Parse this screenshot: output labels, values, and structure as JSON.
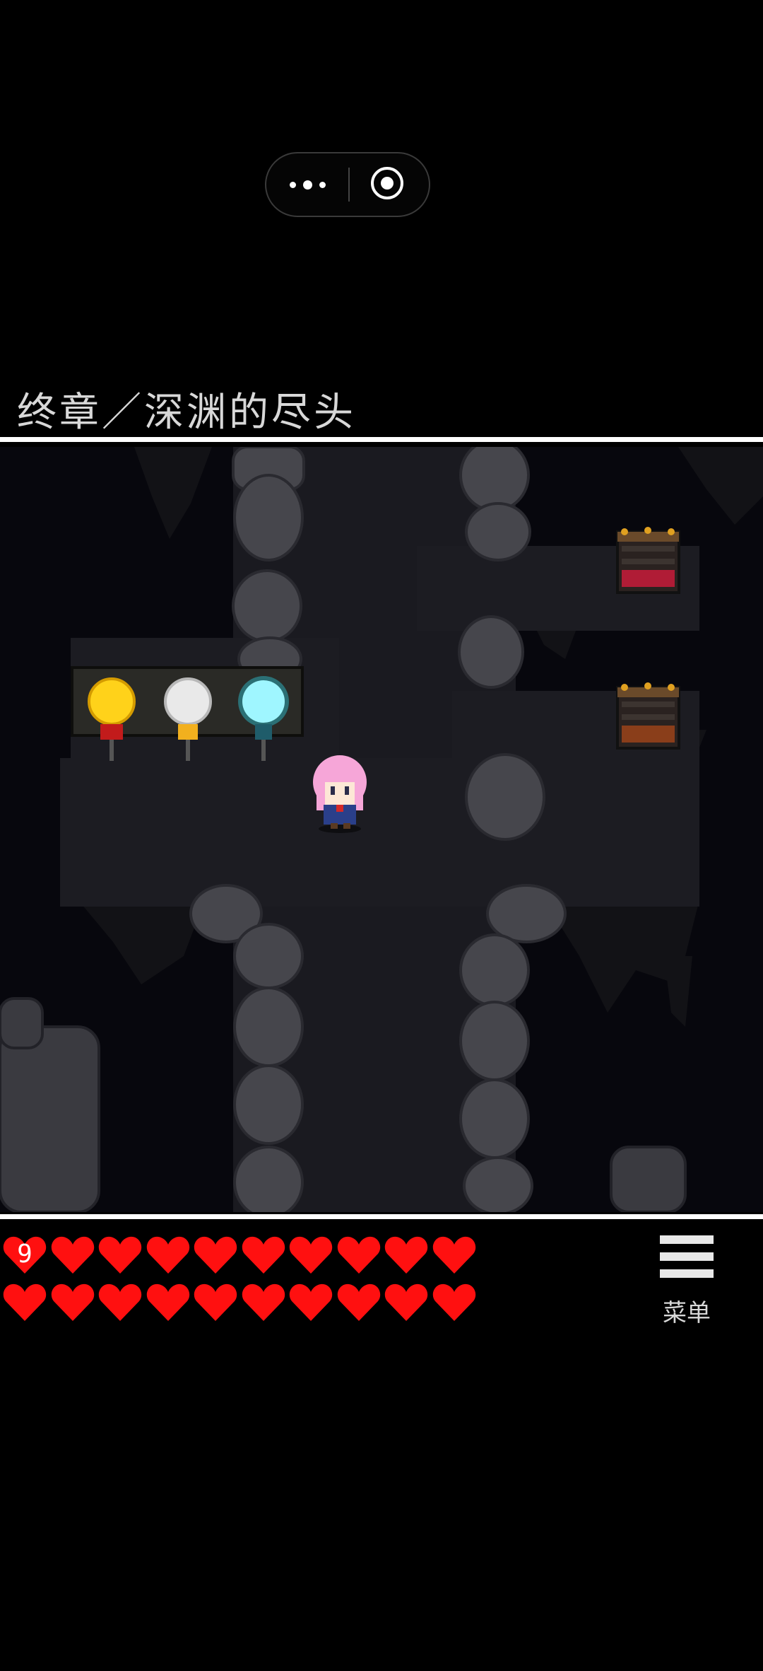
{
  "chapter": {
    "title": "终章／深渊的尽头"
  },
  "hud": {
    "hearts_total": 20,
    "hearts_first_badge": "9",
    "heart_color": "#ff1010"
  },
  "menu": {
    "label": "菜单",
    "icon": "hamburger-menu-icon"
  },
  "scene": {
    "lamps": [
      {
        "name": "yellow-lamp",
        "color": "#ffd21a"
      },
      {
        "name": "white-lamp",
        "color": "#e9e9e9"
      },
      {
        "name": "cyan-lamp",
        "color": "#7ff0ff"
      }
    ],
    "chests": [
      {
        "name": "red-chest",
        "color": "#b01c36"
      },
      {
        "name": "brown-chest",
        "color": "#8a3e1a"
      }
    ],
    "character": "pink-haired-girl"
  }
}
